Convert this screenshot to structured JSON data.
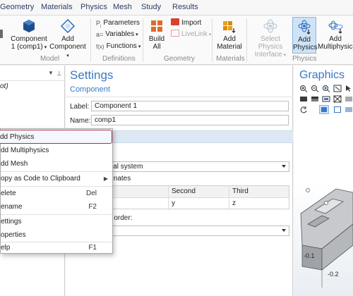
{
  "ribbon_tabs": [
    "Geometry",
    "Materials",
    "Physics",
    "Mesh",
    "Study",
    "Results"
  ],
  "ribbon": {
    "component_label_1": "Component",
    "component_label_2": "1 (comp1)",
    "add_component_label_1": "Add",
    "add_component_label_2": "Component",
    "group_model": "Model",
    "parameters_label": "Parameters",
    "variables_label": "Variables",
    "functions_label": "Functions",
    "group_definitions": "Definitions",
    "build_all_label_1": "Build",
    "build_all_label_2": "All",
    "import_label": "Import",
    "livelink_label": "LiveLink",
    "group_geometry": "Geometry",
    "add_material_label_1": "Add",
    "add_material_label_2": "Material",
    "group_materials": "Materials",
    "select_physics_label_1": "Select Physics",
    "select_physics_label_2": "Interface",
    "add_physics_label_1": "Add",
    "add_physics_label_2": "Physics",
    "add_multiphysics_label_1": "Add",
    "add_multiphysics_label_2": "Multiphysics",
    "group_physics": "Physics"
  },
  "tree": {
    "item_partial": "ot)"
  },
  "context_menu": {
    "items": [
      {
        "label": "dd Physics",
        "shortcut": ""
      },
      {
        "label": "dd Multiphysics",
        "shortcut": ""
      },
      {
        "label": "dd Mesh",
        "shortcut": ""
      },
      {
        "label": "opy as Code to Clipboard",
        "shortcut": ""
      },
      {
        "label": "elete",
        "shortcut": "Del"
      },
      {
        "label": "ename",
        "shortcut": "F2"
      },
      {
        "label": "ettings",
        "shortcut": ""
      },
      {
        "label": "operties",
        "shortcut": ""
      },
      {
        "label": "elp",
        "shortcut": "F1"
      }
    ]
  },
  "settings": {
    "title": "Settings",
    "subtitle": "Component",
    "label_field_label": "Label:",
    "label_field_value": "Component 1",
    "name_field_label": "Name:",
    "name_field_value": "comp1",
    "coord_system_value": "ial system",
    "coordinates_partial": "dinates",
    "grid_headers": [
      "Second",
      "Third"
    ],
    "grid_values": [
      "y",
      "z"
    ],
    "order_label_partial": "e order:"
  },
  "graphics": {
    "title": "Graphics",
    "axis_label_1": "-0.1",
    "axis_label_2": "-0.2"
  },
  "colors": {
    "accent_blue": "#3a78c2",
    "highlight_border": "#b22a4a",
    "section_bar": "#dde8f4"
  }
}
